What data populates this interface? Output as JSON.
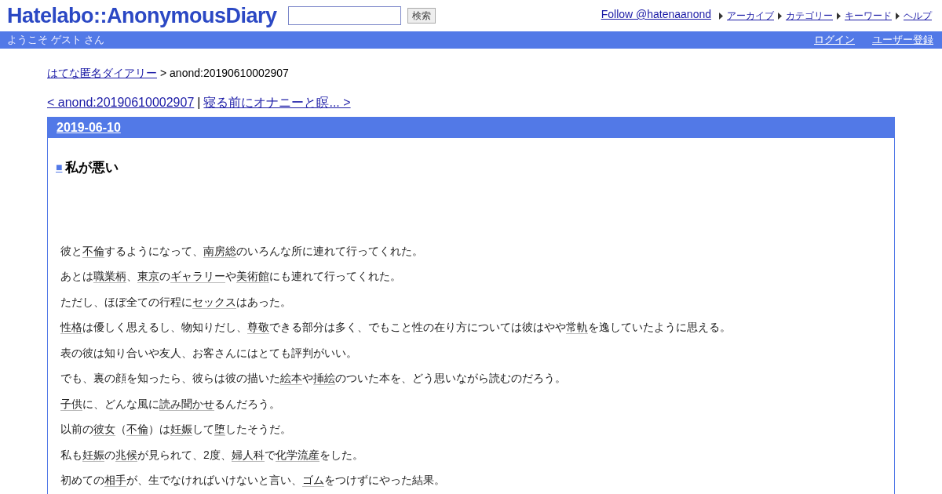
{
  "header": {
    "logo": "Hatelabo::AnonymousDiary",
    "search": {
      "button": "検索"
    },
    "follow": "Follow @hatenaanond",
    "nav": [
      "アーカイブ",
      "カテゴリー",
      "キーワード",
      "ヘルプ"
    ]
  },
  "bar": {
    "welcome": "ようこそ ゲスト さん",
    "links": [
      "ログイン",
      "ユーザー登録"
    ]
  },
  "breadcrumb": {
    "link": "はてな匿名ダイアリー",
    "current": "> anond:20190610002907"
  },
  "pager": {
    "prev": "< anond:20190610002907",
    "separator": "|",
    "next": "寝る前にオナニーと瞑... >"
  },
  "entry": {
    "date": "2019-06-10",
    "mark": "■",
    "title": "私が悪い",
    "paragraphs": [
      [
        {
          "text": "彼と",
          "link": false
        },
        {
          "text": "不倫",
          "link": true
        },
        {
          "text": "するようになって、",
          "link": false
        },
        {
          "text": "南房総",
          "link": true
        },
        {
          "text": "のいろんな所に連れて行ってくれた。",
          "link": false
        }
      ],
      [
        {
          "text": "あとは",
          "link": false
        },
        {
          "text": "職業柄",
          "link": true
        },
        {
          "text": "、",
          "link": false
        },
        {
          "text": "東京",
          "link": true
        },
        {
          "text": "の",
          "link": false
        },
        {
          "text": "ギャラリー",
          "link": true
        },
        {
          "text": "や",
          "link": false
        },
        {
          "text": "美術館",
          "link": true
        },
        {
          "text": "にも連れて行ってくれた。",
          "link": false
        }
      ],
      [
        {
          "text": "ただし、ほぼ全ての行程に",
          "link": false
        },
        {
          "text": "セックス",
          "link": true
        },
        {
          "text": "はあった。",
          "link": false
        }
      ],
      [
        {
          "text": "性格",
          "link": true
        },
        {
          "text": "は優しく思えるし、物知りだし、",
          "link": false
        },
        {
          "text": "尊敬",
          "link": true
        },
        {
          "text": "できる部分は多く、でもこと性の在り方については彼はやや",
          "link": false
        },
        {
          "text": "常軌",
          "link": true
        },
        {
          "text": "を逸していたように思える。",
          "link": false
        }
      ],
      [
        {
          "text": "表の彼は知り合いや友人、お客さんにはとても評判がいい。",
          "link": false
        }
      ],
      [
        {
          "text": "でも、裏の顔を知ったら、彼らは彼の描いた",
          "link": false
        },
        {
          "text": "絵本",
          "link": true
        },
        {
          "text": "や",
          "link": false
        },
        {
          "text": "挿絵",
          "link": true
        },
        {
          "text": "のついた本を、どう思いながら読むのだろう。",
          "link": false
        }
      ],
      [
        {
          "text": "子供",
          "link": true
        },
        {
          "text": "に、どんな風に",
          "link": false
        },
        {
          "text": "読み聞かせ",
          "link": true
        },
        {
          "text": "るんだろう。",
          "link": false
        }
      ],
      [
        {
          "text": "以前の",
          "link": false
        },
        {
          "text": "彼女",
          "link": true
        },
        {
          "text": "（",
          "link": false
        },
        {
          "text": "不倫",
          "link": true
        },
        {
          "text": "）は",
          "link": false
        },
        {
          "text": "妊娠",
          "link": true
        },
        {
          "text": "して",
          "link": false
        },
        {
          "text": "堕",
          "link": true
        },
        {
          "text": "したそうだ。",
          "link": false
        }
      ],
      [
        {
          "text": "私も",
          "link": false
        },
        {
          "text": "妊娠",
          "link": true
        },
        {
          "text": "の",
          "link": false
        },
        {
          "text": "兆候",
          "link": true
        },
        {
          "text": "が見られて、2度、",
          "link": false
        },
        {
          "text": "婦人科",
          "link": true
        },
        {
          "text": "で",
          "link": false
        },
        {
          "text": "化学流産",
          "link": true
        },
        {
          "text": "をした。",
          "link": false
        }
      ],
      [
        {
          "text": "初めての",
          "link": false
        },
        {
          "text": "相手",
          "link": true
        },
        {
          "text": "が、生でなければいけないと言い、",
          "link": false
        },
        {
          "text": "ゴム",
          "link": true
        },
        {
          "text": "をつけずにやった結果。",
          "link": false
        }
      ]
    ]
  }
}
